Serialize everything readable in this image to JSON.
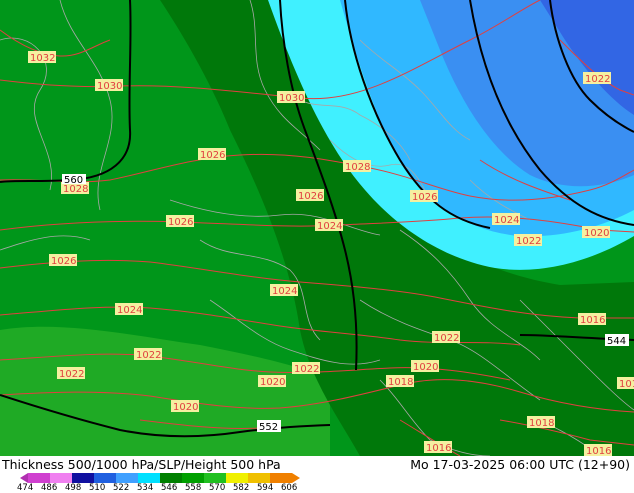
{
  "footer": {
    "title": "Thickness 500/1000 hPa/SLP/Height 500 hPa",
    "time": "Mo 17-03-2025 06:00 UTC (12+90)"
  },
  "colorbar": {
    "ticks": [
      "474",
      "486",
      "498",
      "510",
      "522",
      "534",
      "546",
      "558",
      "570",
      "582",
      "594",
      "606"
    ],
    "colors": [
      "#d040d0",
      "#f080f0",
      "#1010a0",
      "#2060e0",
      "#40a0ff",
      "#00e0ff",
      "#008000",
      "#00a000",
      "#20c020",
      "#f0f000",
      "#f0c000",
      "#f08000"
    ]
  },
  "map": {
    "colors": {
      "dark_green": "#00780a",
      "mid_green": "#00961a",
      "light_green": "#1faa25",
      "cyan": "#40f0ff",
      "light_blue": "#30b8ff",
      "blue": "#3a8ff2",
      "deep_blue": "#3266e4",
      "isobar": "#e04040",
      "border": "#a0a0a0",
      "contour": "#000000"
    },
    "isobar_labels": [
      "1032",
      "1030",
      "1028",
      "1026",
      "1024",
      "1022",
      "1020",
      "1018",
      "1016"
    ],
    "height_labels": [
      "552",
      "544",
      "560"
    ]
  }
}
